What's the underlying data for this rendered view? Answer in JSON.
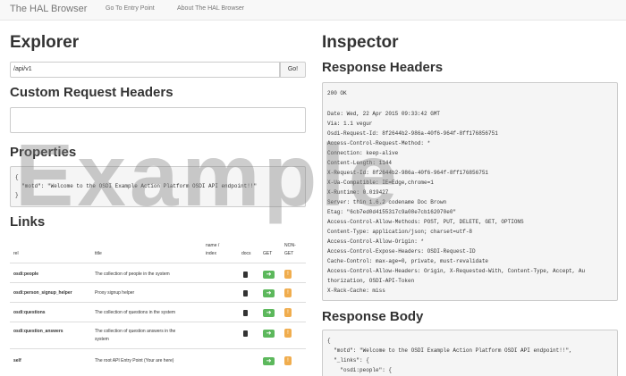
{
  "navbar": {
    "brand": "The HAL Browser",
    "links": [
      "Go To Entry Point",
      "About The HAL Browser"
    ]
  },
  "explorer": {
    "title": "Explorer",
    "url_value": "/api/v1",
    "go_label": "Go!",
    "custom_headers_title": "Custom Request Headers",
    "custom_headers_value": "",
    "properties_title": "Properties",
    "properties_lines": [
      "{",
      "  \"motd\": \"Welcome to the OSDI Example Action Platform OSDI API endpoint!!\"",
      "}"
    ],
    "links_title": "Links",
    "table_headers": {
      "rel": "rel",
      "title": "title",
      "name_index": [
        "name /",
        "index"
      ],
      "docs": "docs",
      "get": "GET",
      "nonget": [
        "NON-",
        "GET"
      ]
    },
    "rows": [
      {
        "rel": "osdi:people",
        "title": [
          "The collection of people in the system"
        ]
      },
      {
        "rel": "osdi:person_signup_helper",
        "title": [
          "Proxy signup helper"
        ]
      },
      {
        "rel": "osdi:questions",
        "title": [
          "The collection of questions in the system"
        ]
      },
      {
        "rel": "osdi:question_answers",
        "title": [
          "The collection of question answers in the",
          "system"
        ]
      },
      {
        "rel": "self",
        "title": [
          "The root API Entry Point (Your are here)"
        ]
      }
    ],
    "get_icon": "arrow-right-icon",
    "nonget_icon": "exclamation-icon",
    "doc_icon": "book-icon"
  },
  "inspector": {
    "title": "Inspector",
    "response_headers_title": "Response Headers",
    "response_headers_lines": [
      "200 OK",
      "",
      "Date: Wed, 22 Apr 2015 09:33:42 GMT",
      "Via: 1.1 vegur",
      "Osdi-Request-Id: 8f2644b2-986a-40f6-964f-8ff176856751",
      "Access-Control-Request-Method: *",
      "Connection: keep-alive",
      "Content-Length: 1144",
      "X-Request-Id: 8f2644b2-986a-40f6-964f-8ff176856751",
      "X-Ua-Compatible: IE=Edge,chrome=1",
      "X-Runtime: 0.019427",
      "Server: thin 1.6.2 codename Doc Brown",
      "Etag: \"6cb7ed0d4155317c9a08e7cb162070e0\"",
      "Access-Control-Allow-Methods: POST, PUT, DELETE, GET, OPTIONS",
      "Content-Type: application/json; charset=utf-8",
      "Access-Control-Allow-Origin: *",
      "Access-Control-Expose-Headers: OSDI-Request-ID",
      "Cache-Control: max-age=0, private, must-revalidate",
      "Access-Control-Allow-Headers: Origin, X-Requested-With, Content-Type, Accept, Au",
      "thorization, OSDI-API-Token",
      "X-Rack-Cache: miss"
    ],
    "response_body_title": "Response Body",
    "response_body_lines": [
      "{",
      "  \"motd\": \"Welcome to the OSDI Example Action Platform OSDI API endpoint!!\",",
      "  \"_links\": {",
      "    \"osdi:people\": {"
    ]
  },
  "watermark": "Example"
}
